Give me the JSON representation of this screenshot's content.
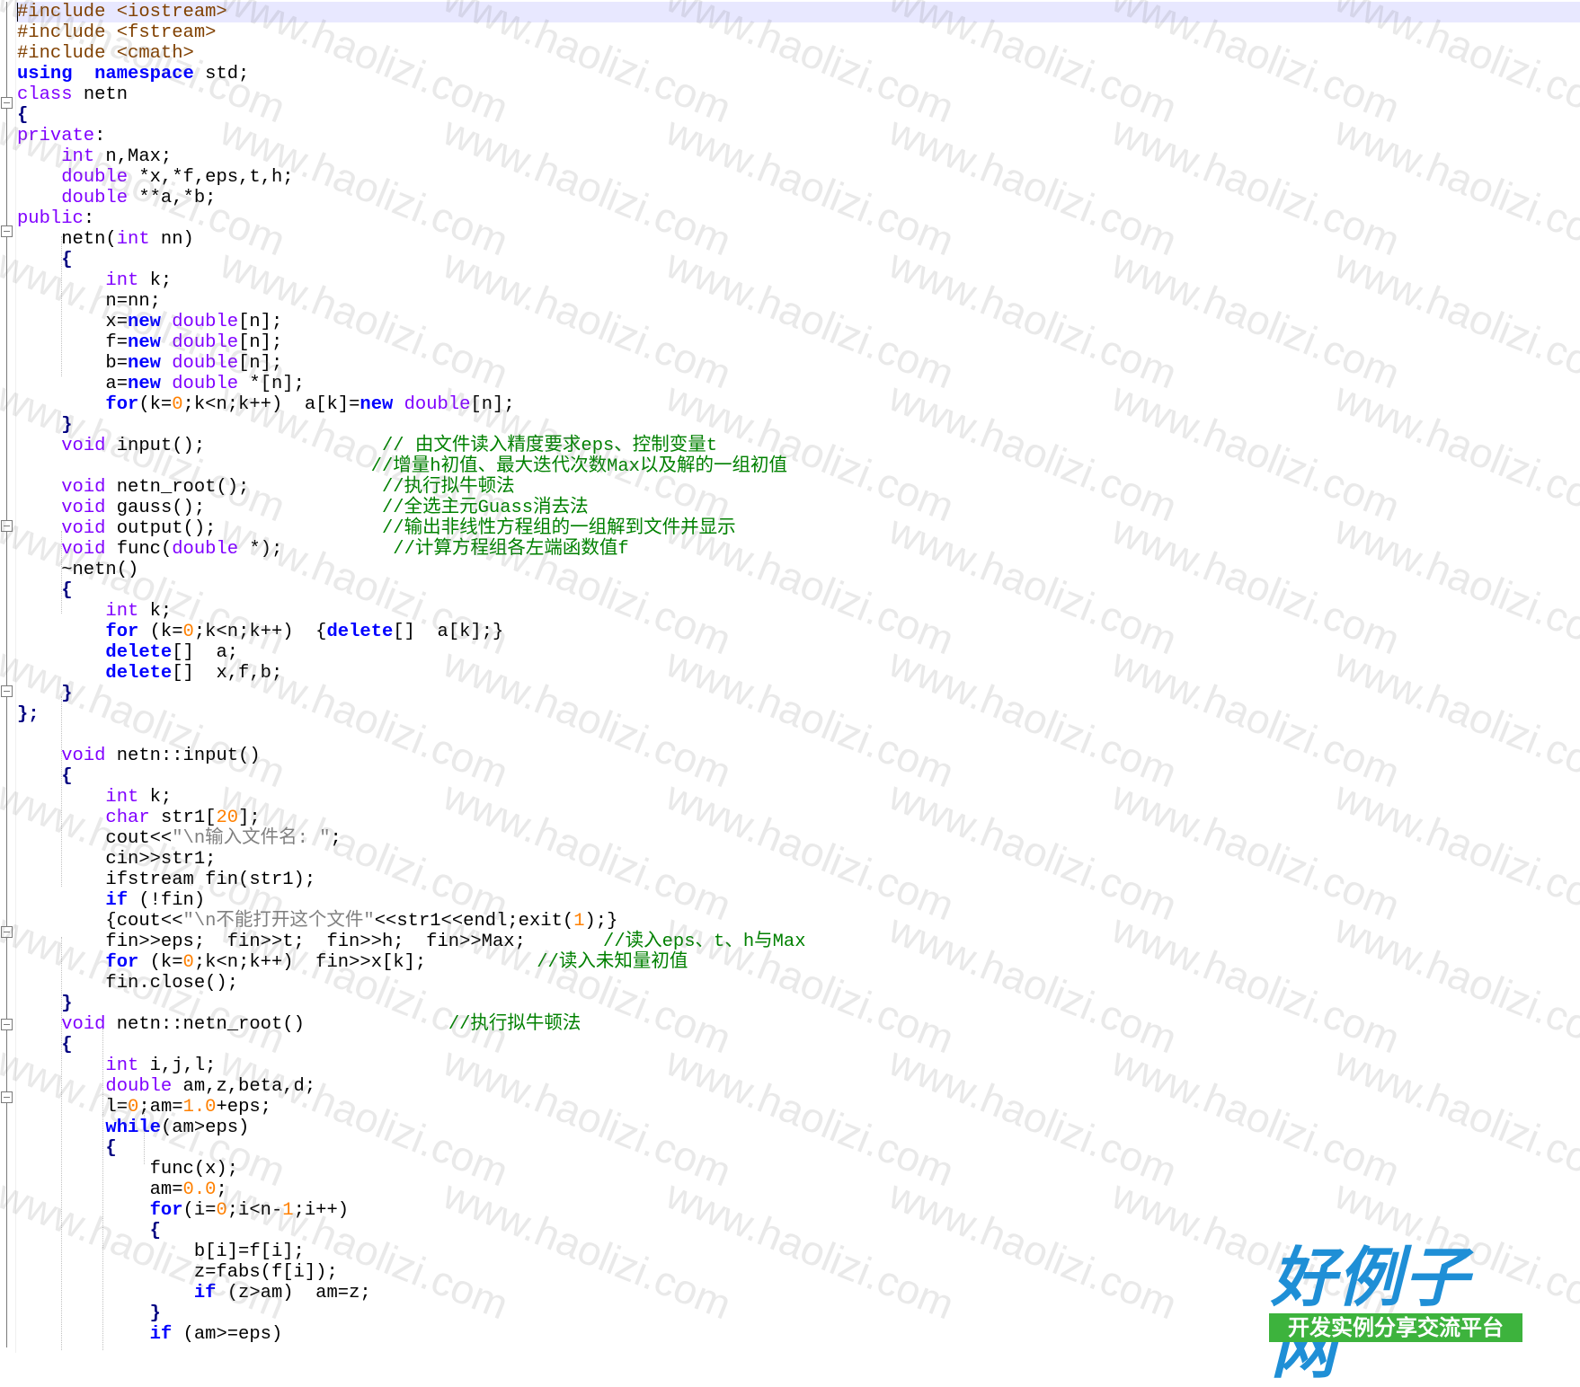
{
  "editor": {
    "language": "cpp",
    "colors": {
      "keyword": "#0000ff",
      "type": "#8000ff",
      "preprocessor": "#804000",
      "number": "#ff8000",
      "string": "#808080",
      "comment": "#008000",
      "current_line": "#e8e8ff"
    },
    "lines": [
      [
        [
          "pp",
          "#include <iostream>"
        ]
      ],
      [
        [
          "pp",
          "#include <fstream>"
        ]
      ],
      [
        [
          "pp",
          "#include <cmath>"
        ]
      ],
      [
        [
          "kw",
          "using"
        ],
        [
          "",
          "  "
        ],
        [
          "kw",
          "namespace"
        ],
        [
          "",
          " std;"
        ]
      ],
      [
        [
          "ty",
          "class"
        ],
        [
          "",
          " netn"
        ]
      ],
      [
        [
          "op",
          "{"
        ]
      ],
      [
        [
          "ty",
          "private"
        ],
        [
          "",
          ":"
        ]
      ],
      [
        [
          "",
          "    "
        ],
        [
          "ty",
          "int"
        ],
        [
          "",
          " n,Max;"
        ]
      ],
      [
        [
          "",
          "    "
        ],
        [
          "ty",
          "double"
        ],
        [
          "",
          " *x,*f,eps,t,h;"
        ]
      ],
      [
        [
          "",
          "    "
        ],
        [
          "ty",
          "double"
        ],
        [
          "",
          " **a,*b;"
        ]
      ],
      [
        [
          "ty",
          "public"
        ],
        [
          "",
          ":"
        ]
      ],
      [
        [
          "",
          "    netn("
        ],
        [
          "ty",
          "int"
        ],
        [
          "",
          " nn)"
        ]
      ],
      [
        [
          "",
          "    "
        ],
        [
          "op",
          "{"
        ]
      ],
      [
        [
          "",
          "        "
        ],
        [
          "ty",
          "int"
        ],
        [
          "",
          " k;"
        ]
      ],
      [
        [
          "",
          "        n=nn;"
        ]
      ],
      [
        [
          "",
          "        x="
        ],
        [
          "kw",
          "new"
        ],
        [
          "",
          " "
        ],
        [
          "ty",
          "double"
        ],
        [
          "",
          "[n];"
        ]
      ],
      [
        [
          "",
          "        f="
        ],
        [
          "kw",
          "new"
        ],
        [
          "",
          " "
        ],
        [
          "ty",
          "double"
        ],
        [
          "",
          "[n];"
        ]
      ],
      [
        [
          "",
          "        b="
        ],
        [
          "kw",
          "new"
        ],
        [
          "",
          " "
        ],
        [
          "ty",
          "double"
        ],
        [
          "",
          "[n];"
        ]
      ],
      [
        [
          "",
          "        a="
        ],
        [
          "kw",
          "new"
        ],
        [
          "",
          " "
        ],
        [
          "ty",
          "double"
        ],
        [
          "",
          " *[n];"
        ]
      ],
      [
        [
          "",
          "        "
        ],
        [
          "kw",
          "for"
        ],
        [
          "",
          "(k="
        ],
        [
          "num",
          "0"
        ],
        [
          "",
          ";k<n;k++)  a[k]="
        ],
        [
          "kw",
          "new"
        ],
        [
          "",
          " "
        ],
        [
          "ty",
          "double"
        ],
        [
          "",
          "[n];"
        ]
      ],
      [
        [
          "",
          "    "
        ],
        [
          "op",
          "}"
        ]
      ],
      [
        [
          "",
          "    "
        ],
        [
          "ty",
          "void"
        ],
        [
          "",
          " input();                "
        ],
        [
          "cm",
          "// 由文件读入精度要求eps、控制变量t"
        ]
      ],
      [
        [
          "",
          "                                "
        ],
        [
          "cm",
          "//增量h初值、最大迭代次数Max以及解的一组初值"
        ]
      ],
      [
        [
          "",
          "    "
        ],
        [
          "ty",
          "void"
        ],
        [
          "",
          " netn_root();            "
        ],
        [
          "cm",
          "//执行拟牛顿法"
        ]
      ],
      [
        [
          "",
          "    "
        ],
        [
          "ty",
          "void"
        ],
        [
          "",
          " gauss();                "
        ],
        [
          "cm",
          "//全选主元Guass消去法"
        ]
      ],
      [
        [
          "",
          "    "
        ],
        [
          "ty",
          "void"
        ],
        [
          "",
          " output();               "
        ],
        [
          "cm",
          "//输出非线性方程组的一组解到文件并显示"
        ]
      ],
      [
        [
          "",
          "    "
        ],
        [
          "ty",
          "void"
        ],
        [
          "",
          " func("
        ],
        [
          "ty",
          "double"
        ],
        [
          "",
          " *);          "
        ],
        [
          "cm",
          "//计算方程组各左端函数值f"
        ]
      ],
      [
        [
          "",
          "    ~netn()"
        ]
      ],
      [
        [
          "",
          "    "
        ],
        [
          "op",
          "{"
        ]
      ],
      [
        [
          "",
          "        "
        ],
        [
          "ty",
          "int"
        ],
        [
          "",
          " k;"
        ]
      ],
      [
        [
          "",
          "        "
        ],
        [
          "kw",
          "for"
        ],
        [
          "",
          " (k="
        ],
        [
          "num",
          "0"
        ],
        [
          "",
          ";k<n;k++)  {"
        ],
        [
          "kw",
          "delete"
        ],
        [
          "",
          "[]  a[k];}"
        ]
      ],
      [
        [
          "",
          "        "
        ],
        [
          "kw",
          "delete"
        ],
        [
          "",
          "[]  a;"
        ]
      ],
      [
        [
          "",
          "        "
        ],
        [
          "kw",
          "delete"
        ],
        [
          "",
          "[]  x,f,b;"
        ]
      ],
      [
        [
          "",
          "    "
        ],
        [
          "op",
          "}"
        ]
      ],
      [
        [
          "op",
          "};"
        ]
      ],
      [
        [
          "",
          ""
        ]
      ],
      [
        [
          "",
          "    "
        ],
        [
          "ty",
          "void"
        ],
        [
          "",
          " netn::input()"
        ]
      ],
      [
        [
          "",
          "    "
        ],
        [
          "op",
          "{"
        ]
      ],
      [
        [
          "",
          "        "
        ],
        [
          "ty",
          "int"
        ],
        [
          "",
          " k;"
        ]
      ],
      [
        [
          "",
          "        "
        ],
        [
          "ty",
          "char"
        ],
        [
          "",
          " str1["
        ],
        [
          "num",
          "20"
        ],
        [
          "",
          "];"
        ]
      ],
      [
        [
          "",
          "        cout<<"
        ],
        [
          "str",
          "\"\\n输入文件名: \""
        ],
        [
          "",
          ";"
        ]
      ],
      [
        [
          "",
          "        cin>>str1;"
        ]
      ],
      [
        [
          "",
          "        ifstream fin(str1);"
        ]
      ],
      [
        [
          "",
          "        "
        ],
        [
          "kw",
          "if"
        ],
        [
          "",
          " (!fin)"
        ]
      ],
      [
        [
          "",
          "        {cout<<"
        ],
        [
          "str",
          "\"\\n不能打开这个文件\""
        ],
        [
          "",
          "<<str1<<endl;exit("
        ],
        [
          "num",
          "1"
        ],
        [
          "",
          ");}"
        ]
      ],
      [
        [
          "",
          "        fin>>eps;  fin>>t;  fin>>h;  fin>>Max;       "
        ],
        [
          "cm",
          "//读入eps、t、h与Max"
        ]
      ],
      [
        [
          "",
          "        "
        ],
        [
          "kw",
          "for"
        ],
        [
          "",
          " (k="
        ],
        [
          "num",
          "0"
        ],
        [
          "",
          ";k<n;k++)  fin>>x[k];          "
        ],
        [
          "cm",
          "//读入未知量初值"
        ]
      ],
      [
        [
          "",
          "        fin.close();"
        ]
      ],
      [
        [
          "",
          "    "
        ],
        [
          "op",
          "}"
        ]
      ],
      [
        [
          "",
          "    "
        ],
        [
          "ty",
          "void"
        ],
        [
          "",
          " netn::netn_root()             "
        ],
        [
          "cm",
          "//执行拟牛顿法"
        ]
      ],
      [
        [
          "",
          "    "
        ],
        [
          "op",
          "{"
        ]
      ],
      [
        [
          "",
          "        "
        ],
        [
          "ty",
          "int"
        ],
        [
          "",
          " i,j,l;"
        ]
      ],
      [
        [
          "",
          "        "
        ],
        [
          "ty",
          "double"
        ],
        [
          "",
          " am,z,beta,d;"
        ]
      ],
      [
        [
          "",
          "        l="
        ],
        [
          "num",
          "0"
        ],
        [
          "",
          ";am="
        ],
        [
          "num",
          "1.0"
        ],
        [
          "",
          "+eps;"
        ]
      ],
      [
        [
          "",
          "        "
        ],
        [
          "kw",
          "while"
        ],
        [
          "",
          "(am>eps)"
        ]
      ],
      [
        [
          "",
          "        "
        ],
        [
          "op",
          "{"
        ]
      ],
      [
        [
          "",
          "            func(x);"
        ]
      ],
      [
        [
          "",
          "            am="
        ],
        [
          "num",
          "0.0"
        ],
        [
          "",
          ";"
        ]
      ],
      [
        [
          "",
          "            "
        ],
        [
          "kw",
          "for"
        ],
        [
          "",
          "(i="
        ],
        [
          "num",
          "0"
        ],
        [
          "",
          ";i<n-"
        ],
        [
          "num",
          "1"
        ],
        [
          "",
          ";i++)"
        ]
      ],
      [
        [
          "",
          "            "
        ],
        [
          "op",
          "{"
        ]
      ],
      [
        [
          "",
          "                b[i]=f[i];"
        ]
      ],
      [
        [
          "",
          "                z=fabs(f[i]);"
        ]
      ],
      [
        [
          "",
          "                "
        ],
        [
          "kw",
          "if"
        ],
        [
          "",
          " (z>am)  am=z;"
        ]
      ],
      [
        [
          "",
          "            "
        ],
        [
          "op",
          "}"
        ]
      ],
      [
        [
          "",
          "            "
        ],
        [
          "kw",
          "if"
        ],
        [
          "",
          " (am>=eps)"
        ]
      ]
    ]
  },
  "watermark": {
    "text": "www.haolizi.com"
  },
  "logo": {
    "title": "好例子网",
    "subtitle": "开发实例分享交流平台"
  }
}
